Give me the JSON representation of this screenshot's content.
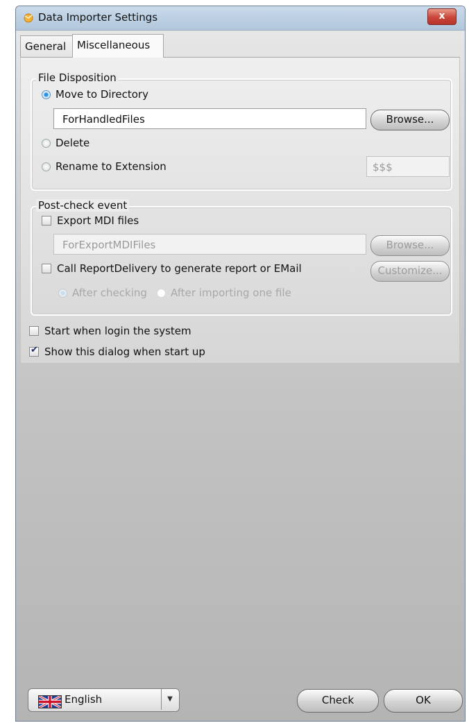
{
  "window": {
    "title": "Data Importer Settings",
    "close_label": "x"
  },
  "tabs": [
    {
      "label": "General",
      "active": false
    },
    {
      "label": "Miscellaneous",
      "active": true
    }
  ],
  "file_disposition": {
    "group_label": "File Disposition",
    "move_label": "Move to Directory",
    "move_selected": true,
    "directory_value": "ForHandledFiles",
    "browse_label": "Browse...",
    "delete_label": "Delete",
    "rename_label": "Rename to Extension",
    "extension_value": "$$$"
  },
  "post_check": {
    "group_label": "Post-check event",
    "export_label": "Export MDI files",
    "export_checked": false,
    "export_dir_value": "ForExportMDIFiles",
    "browse_label": "Browse...",
    "report_label": "Call ReportDelivery to generate report or EMail",
    "report_checked": false,
    "customize_label": "Customize...",
    "after_checking_label": "After checking",
    "after_importing_label": "After importing one file"
  },
  "options": {
    "start_login_label": "Start when login the system",
    "start_login_checked": false,
    "show_dialog_label": "Show this dialog when start up",
    "show_dialog_checked": true
  },
  "footer": {
    "language_value": "English",
    "check_label": "Check",
    "ok_label": "OK"
  },
  "colors": {
    "title_bar": "#bcd0e4",
    "close_button": "#c9453a",
    "radio_selected": "#2a8fe0"
  }
}
